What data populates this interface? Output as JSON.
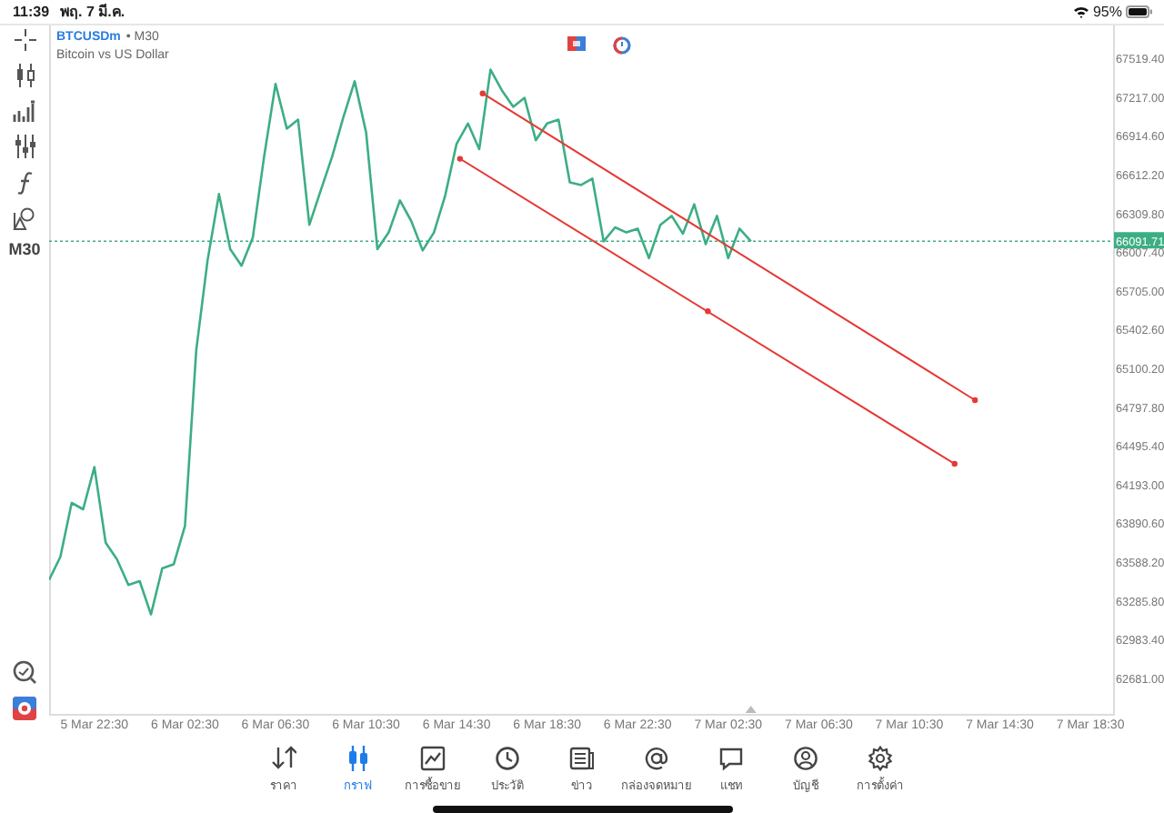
{
  "status_bar": {
    "time": "11:39",
    "date": "พฤ. 7 มี.ค.",
    "battery": "95%"
  },
  "symbol": {
    "name": "BTCUSDm",
    "timeframe": "• M30",
    "description": "Bitcoin vs US Dollar"
  },
  "toolbar": {
    "timeframe": "M30"
  },
  "chart": {
    "chart_data": {
      "type": "line",
      "categories": [
        null,
        null,
        null,
        null,
        "5 Mar 22:30",
        null,
        null,
        null,
        null,
        null,
        null,
        null,
        "6 Mar 02:30",
        null,
        null,
        null,
        null,
        null,
        null,
        null,
        "6 Mar 06:30",
        null,
        null,
        null,
        null,
        null,
        null,
        null,
        "6 Mar 10:30",
        null,
        null,
        null,
        null,
        null,
        null,
        null,
        "6 Mar 14:30",
        null,
        null,
        null,
        null,
        null,
        null,
        null,
        "6 Mar 18:30",
        null,
        null,
        null,
        null,
        null,
        null,
        null,
        "6 Mar 22:30",
        null,
        null,
        null,
        null,
        null,
        null,
        null,
        "7 Mar 02:30",
        null,
        null,
        null,
        null,
        null,
        null,
        null,
        "7 Mar 06:30",
        null,
        null,
        null,
        null,
        null,
        null,
        null,
        "7 Mar 10:30",
        null,
        null,
        null,
        null,
        null,
        null,
        null,
        "7 Mar 14:30",
        null,
        null,
        null,
        null,
        null,
        null,
        null,
        "7 Mar 18:30",
        null
      ],
      "series": [
        {
          "color": "#3dae84",
          "values": [
            63450,
            63630,
            64050,
            64000,
            64330,
            63740,
            63610,
            63410,
            63440,
            63180,
            63540,
            63570,
            63870,
            65240,
            65940,
            66460,
            66030,
            65900,
            66120,
            66750,
            67320,
            66970,
            67040,
            66220,
            66490,
            66750,
            67060,
            67340,
            66940,
            66030,
            66160,
            66410,
            66250,
            66020,
            66160,
            66450,
            66850,
            67010,
            66810,
            67430,
            67270,
            67140,
            67210,
            66880,
            67010,
            67040,
            66550,
            66530,
            66580,
            66090,
            66200,
            66160,
            66190,
            65960,
            66220,
            66290,
            66150,
            66380,
            66070,
            66290,
            65960,
            66190,
            66090,
            null,
            null,
            null,
            null,
            null,
            null,
            null,
            null,
            null,
            null,
            null,
            null,
            null,
            null,
            null,
            null,
            null,
            null,
            null,
            null,
            null,
            null,
            null,
            null,
            null,
            null,
            null,
            null,
            null,
            null,
            null
          ]
        }
      ],
      "ylim": [
        62397,
        67775
      ],
      "yticks": [
        {
          "value": 67519.4,
          "label": "67519.40"
        },
        {
          "value": 67217,
          "label": "67217.00"
        },
        {
          "value": 66914.6,
          "label": "66914.60"
        },
        {
          "value": 66612.2,
          "label": "66612.20"
        },
        {
          "value": 66309.8,
          "label": "66309.80"
        },
        {
          "value": 66007.4,
          "label": "66007.40"
        },
        {
          "value": 65705,
          "label": "65705.00"
        },
        {
          "value": 65402.6,
          "label": "65402.60"
        },
        {
          "value": 65100.2,
          "label": "65100.20"
        },
        {
          "value": 64797.8,
          "label": "64797.80"
        },
        {
          "value": 64495.4,
          "label": "64495.40"
        },
        {
          "value": 64193,
          "label": "64193.00"
        },
        {
          "value": 63890.6,
          "label": "63890.60"
        },
        {
          "value": 63588.2,
          "label": "63588.20"
        },
        {
          "value": 63285.8,
          "label": "63285.80"
        },
        {
          "value": 62983.4,
          "label": "62983.40"
        },
        {
          "value": 62681,
          "label": "62681.00"
        }
      ],
      "ref_lines": [
        {
          "axis": "y",
          "value": 66091.71,
          "label": "66091.71",
          "color": "#3dae84"
        }
      ]
    }
  },
  "tabs": [
    {
      "label": "ราคา",
      "selected": false
    },
    {
      "label": "กราฟ",
      "selected": true
    },
    {
      "label": "การซื้อขาย",
      "selected": false
    },
    {
      "label": "ประวัติ",
      "selected": false
    },
    {
      "label": "ข่าว",
      "selected": false
    },
    {
      "label": "กล่องจดหมาย",
      "selected": false
    },
    {
      "label": "แชท",
      "selected": false
    },
    {
      "label": "บัญชี",
      "selected": false
    },
    {
      "label": "การตั้งค่า",
      "selected": false
    }
  ]
}
